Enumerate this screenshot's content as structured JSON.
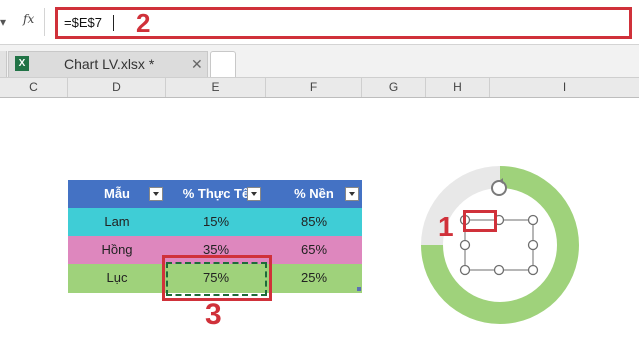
{
  "formula_bar": {
    "name_box_tail": "▾",
    "fx_label": "fx",
    "value": "=$E$7"
  },
  "workbook_tab": {
    "icon_text": "X",
    "title": "Chart LV.xlsx *",
    "close_glyph": "✕"
  },
  "column_headers": [
    "C",
    "D",
    "E",
    "F",
    "G",
    "H",
    "I"
  ],
  "table": {
    "headers": [
      "Mẫu",
      "% Thực Tế",
      "% Nền"
    ],
    "rows": [
      {
        "mau": "Lam",
        "thuc_te": "15%",
        "nen": "85%",
        "color": "#3fcdd6"
      },
      {
        "mau": "Hồng",
        "thuc_te": "35%",
        "nen": "65%",
        "color": "#de87be"
      },
      {
        "mau": "Lục",
        "thuc_te": "75%",
        "nen": "25%",
        "color": "#9fd27b"
      }
    ],
    "header_color": "#4472c4"
  },
  "annotations": {
    "one": "1",
    "two": "2",
    "three": "3",
    "color": "#d0313a"
  },
  "chart_data": {
    "type": "pie",
    "subtype": "doughnut",
    "values": [
      75,
      25
    ],
    "colors": [
      "#9fd27b",
      "#e8e8e8"
    ]
  }
}
